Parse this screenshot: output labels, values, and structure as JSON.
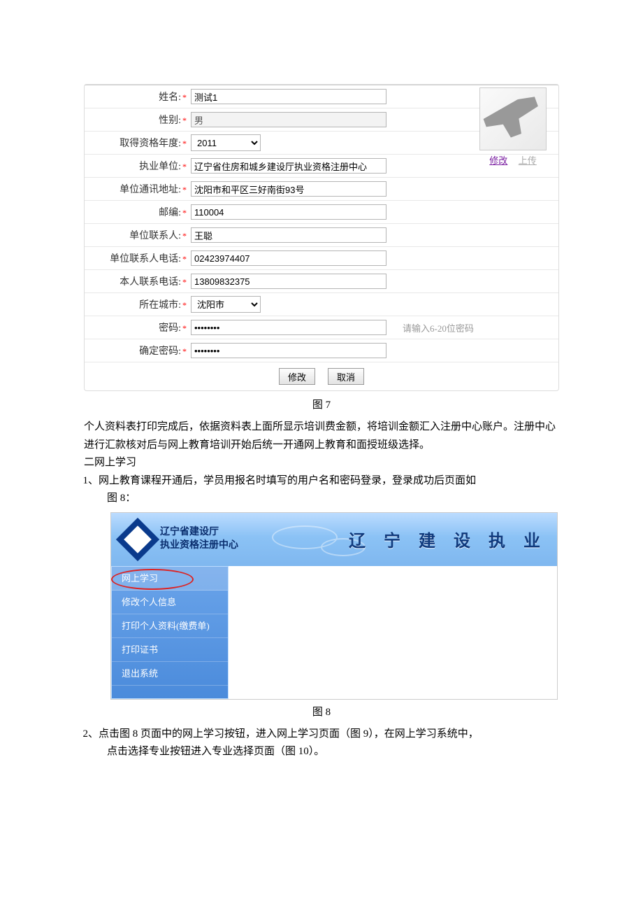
{
  "form": {
    "fields": {
      "name": {
        "label": "姓名:",
        "value": "测试1"
      },
      "gender": {
        "label": "性别:",
        "value": "男"
      },
      "qual_year": {
        "label": "取得资格年度:",
        "value": "2011"
      },
      "work_unit": {
        "label": "执业单位:",
        "value": "辽宁省住房和城乡建设厅执业资格注册中心"
      },
      "unit_addr": {
        "label": "单位通讯地址:",
        "value": "沈阳市和平区三好南街93号"
      },
      "postcode": {
        "label": "邮编:",
        "value": "110004"
      },
      "unit_contact": {
        "label": "单位联系人:",
        "value": "王聪"
      },
      "unit_phone": {
        "label": "单位联系人电话:",
        "value": "02423974407"
      },
      "self_phone": {
        "label": "本人联系电话:",
        "value": "13809832375"
      },
      "city": {
        "label": "所在城市:",
        "value": "沈阳市"
      },
      "pwd": {
        "label": "密码:",
        "value": "••••••••",
        "hint": "请输入6-20位密码"
      },
      "pwd2": {
        "label": "确定密码:",
        "value": "••••••••"
      }
    },
    "photo_links": {
      "edit": "修改",
      "upload": "上传"
    },
    "buttons": {
      "ok": "修改",
      "cancel": "取消"
    }
  },
  "captions": {
    "fig7": "图 7",
    "fig8": "图 8"
  },
  "text": {
    "p1": "个人资料表打印完成后，依据资料表上面所显示培训费金额，将培训金额汇入注册中心账户。注册中心进行汇款核对后与网上教育培训开始后统一开通网上教育和面授班级选择。",
    "h2": "二网上学习",
    "l1a": "1、网上教育课程开通后，学员用报名时填写的用户名和密码登录，登录成功后页面如",
    "l1b": "图 8：",
    "l2a": "2、点击图 8 页面中的网上学习按钮，进入网上学习页面（图 9），在网上学习系统中，",
    "l2b": "点击选择专业按钮进入专业选择页面（图 10）。"
  },
  "fig8": {
    "org_line1": "辽宁省建设厅",
    "org_line2": "执业资格注册中心",
    "right_title": "辽 宁 建 设 执 业",
    "menu": [
      "网上学习",
      "修改个人信息",
      "打印个人资料(缴费单)",
      "打印证书",
      "退出系统"
    ]
  }
}
